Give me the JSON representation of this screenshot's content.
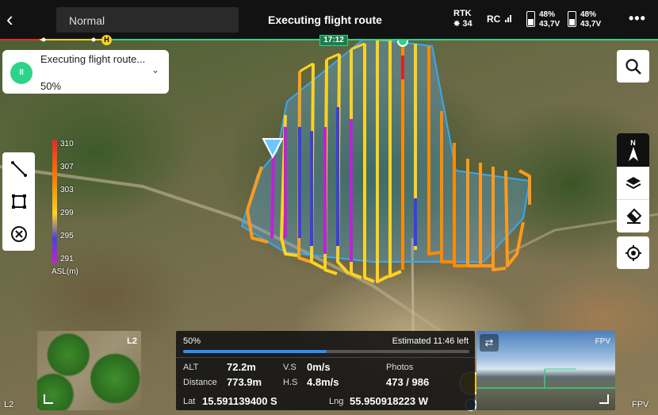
{
  "topbar": {
    "mode": "Normal",
    "title": "Executing flight route",
    "rtk_label": "RTK",
    "rtk_count": "34",
    "rc_label": "RC",
    "battery1_pct": "48%",
    "battery1_v": "43,7V",
    "battery2_pct": "48%",
    "battery2_v": "43,7V"
  },
  "route": {
    "time": "17:12",
    "home_marker": "H"
  },
  "status": {
    "line1": "Executing flight route...",
    "percent": "50%"
  },
  "legend": {
    "ticks": [
      "310",
      "307",
      "303",
      "299",
      "295",
      "291"
    ],
    "unit": "ASL(m)"
  },
  "thumb": {
    "label": "L2"
  },
  "telemetry": {
    "progress_text": "50%",
    "progress": 0.5,
    "estimated": "Estimated 11:46 left",
    "alt_label": "ALT",
    "alt_value": "72.2m",
    "vs_label": "V.S",
    "vs_value": "0m/s",
    "photos_label": "Photos",
    "photos_value": "473 / 986",
    "dist_label": "Distance",
    "dist_value": "773.9m",
    "hs_label": "H.S",
    "hs_value": "4.8m/s",
    "lat_label": "Lat",
    "lat_value": "15.591139400 S",
    "lng_label": "Lng",
    "lng_value": "55.950918223 W"
  },
  "fpv": {
    "label": "FPV"
  },
  "edges": {
    "left_bottom": "L2",
    "right_bottom": "FPV"
  },
  "colors": {
    "accent_green": "#2ed38a",
    "progress_blue": "#2f8ef5",
    "route_yellow": "#ffd21f",
    "route_orange": "#ff8a00",
    "route_blue": "#3b3fe0",
    "route_purple": "#c020d8"
  }
}
